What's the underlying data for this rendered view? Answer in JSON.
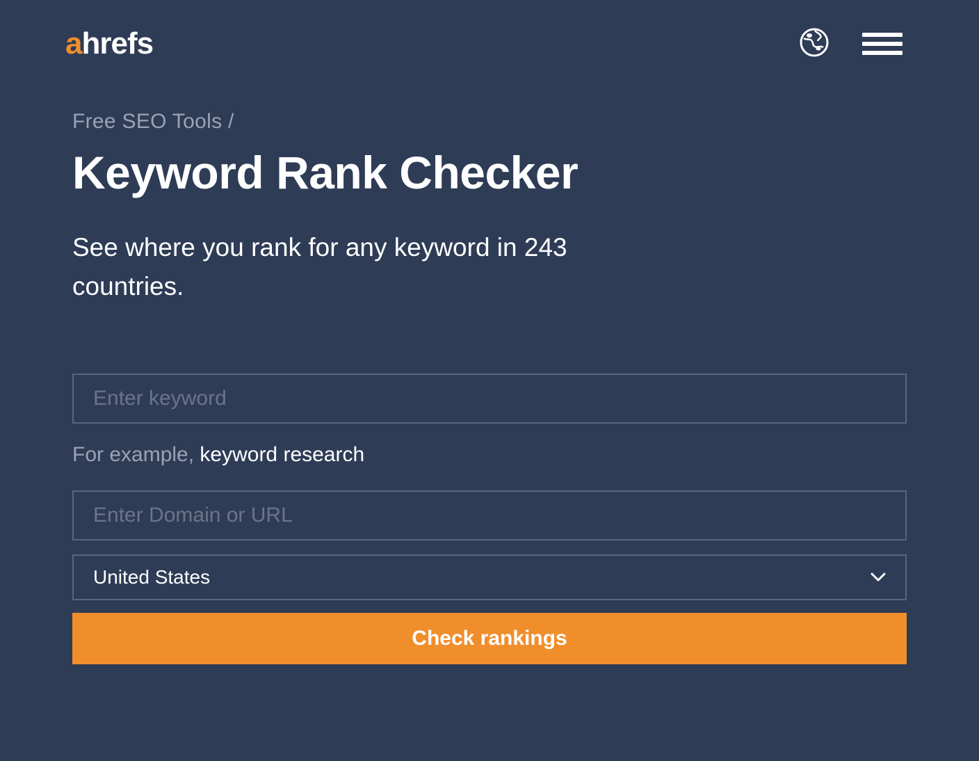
{
  "header": {
    "logo_a": "a",
    "logo_rest": "hrefs"
  },
  "breadcrumb": "Free SEO Tools /",
  "title": "Keyword Rank Checker",
  "subtitle": "See where you rank for any keyword in 243 countries.",
  "form": {
    "keyword_placeholder": "Enter keyword",
    "example_prefix": "For example, ",
    "example_value": "keyword research",
    "domain_placeholder": "Enter Domain or URL",
    "country_selected": "United States",
    "submit_label": "Check rankings"
  }
}
